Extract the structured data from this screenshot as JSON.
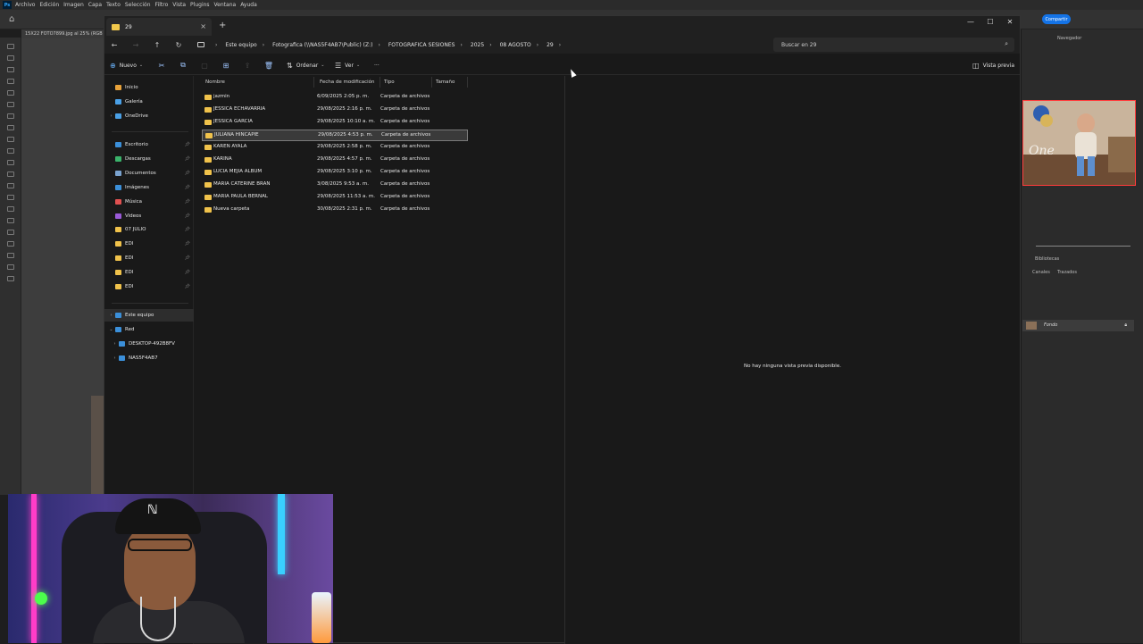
{
  "photoshop": {
    "menu": [
      "Archivo",
      "Edición",
      "Imagen",
      "Capa",
      "Texto",
      "Selección",
      "Filtro",
      "Vista",
      "Plugins",
      "Ventana",
      "Ayuda"
    ],
    "doc_tab": "15X22 FOTO7899.jpg al 25% (RGB",
    "share_label": "Compartir",
    "panel_tabs": [
      "Navegador"
    ],
    "layers_tabs": [
      "Bibliotecas",
      "Canales",
      "Trazados"
    ],
    "layer_name": "Fondo"
  },
  "explorer": {
    "tab_title": "29",
    "breadcrumb": [
      "Este equipo",
      "Fotografica (\\\\NAS5F4AB7\\Public) (Z:)",
      "FOTOGRAFICA SESIONES",
      "2025",
      "08 AGOSTO",
      "29"
    ],
    "search_placeholder": "Buscar en 29",
    "cmd": {
      "new_label": "Nuevo",
      "sort_label": "Ordenar",
      "view_label": "Ver",
      "more_label": "···",
      "preview_label": "Vista previa"
    },
    "nav": {
      "top": [
        {
          "label": "Inicio",
          "icon": "home-icon",
          "color": "#e8a23a",
          "expander": ""
        },
        {
          "label": "Galería",
          "icon": "gallery-icon",
          "color": "#4aa0e6",
          "expander": ""
        },
        {
          "label": "OneDrive",
          "icon": "cloud-icon",
          "color": "#4aa0e6",
          "expander": "›"
        }
      ],
      "quick": [
        {
          "label": "Escritorio",
          "icon": "desktop-icon",
          "color": "#3b8fd9"
        },
        {
          "label": "Descargas",
          "icon": "download-icon",
          "color": "#3bb36b"
        },
        {
          "label": "Documentos",
          "icon": "document-icon",
          "color": "#7aa3cf"
        },
        {
          "label": "Imágenes",
          "icon": "images-icon",
          "color": "#3b8fd9"
        },
        {
          "label": "Música",
          "icon": "music-icon",
          "color": "#e05050"
        },
        {
          "label": "Videos",
          "icon": "video-icon",
          "color": "#9a5ad8"
        },
        {
          "label": "07 JULIO",
          "icon": "folder-icon",
          "color": "#f0c24b"
        },
        {
          "label": "EDI",
          "icon": "folder-icon",
          "color": "#f0c24b"
        },
        {
          "label": "EDI",
          "icon": "folder-icon",
          "color": "#f0c24b"
        },
        {
          "label": "EDI",
          "icon": "folder-icon",
          "color": "#f0c24b"
        },
        {
          "label": "EDI",
          "icon": "folder-icon",
          "color": "#f0c24b"
        }
      ],
      "bottom": [
        {
          "label": "Este equipo",
          "icon": "pc-icon",
          "color": "#3b8fd9",
          "expander": "›"
        },
        {
          "label": "Red",
          "icon": "network-icon",
          "color": "#3b8fd9",
          "expander": "⌄"
        },
        {
          "label": "DESKTOP-492B8FV",
          "icon": "pc-icon",
          "color": "#3b8fd9",
          "expander": "›"
        },
        {
          "label": "NAS5F4AB7",
          "icon": "pc-icon",
          "color": "#3b8fd9",
          "expander": "›"
        }
      ]
    },
    "columns": [
      "Nombre",
      "Fecha de modificación",
      "Tipo",
      "Tamaño"
    ],
    "files": [
      {
        "name": "jazmin",
        "date": "6/09/2025 2:05 p. m.",
        "type": "Carpeta de archivos"
      },
      {
        "name": "JESSICA ECHAVARRIA",
        "date": "29/08/2025 2:16 p. m.",
        "type": "Carpeta de archivos"
      },
      {
        "name": "JESSICA GARCIA",
        "date": "29/08/2025 10:10 a. m.",
        "type": "Carpeta de archivos"
      },
      {
        "name": "JULIANA HINCAPIE",
        "date": "29/08/2025 4:53 p. m.",
        "type": "Carpeta de archivos"
      },
      {
        "name": "KAREN AYALA",
        "date": "29/08/2025 2:58 p. m.",
        "type": "Carpeta de archivos"
      },
      {
        "name": "KARINA",
        "date": "29/08/2025 4:57 p. m.",
        "type": "Carpeta de archivos"
      },
      {
        "name": "LUCIA MEJIA ALBUM",
        "date": "29/08/2025 3:10 p. m.",
        "type": "Carpeta de archivos"
      },
      {
        "name": "MARIA CATERINE BRAN",
        "date": "3/08/2025 9:53 a. m.",
        "type": "Carpeta de archivos"
      },
      {
        "name": "MARIA PAULA BERNAL",
        "date": "29/08/2025 11:53 a. m.",
        "type": "Carpeta de archivos"
      },
      {
        "name": "Nueva carpeta",
        "date": "30/08/2025 2:31 p. m.",
        "type": "Carpeta de archivos"
      }
    ],
    "selected_index": 3,
    "preview_message": "No hay ninguna vista previa disponible."
  }
}
